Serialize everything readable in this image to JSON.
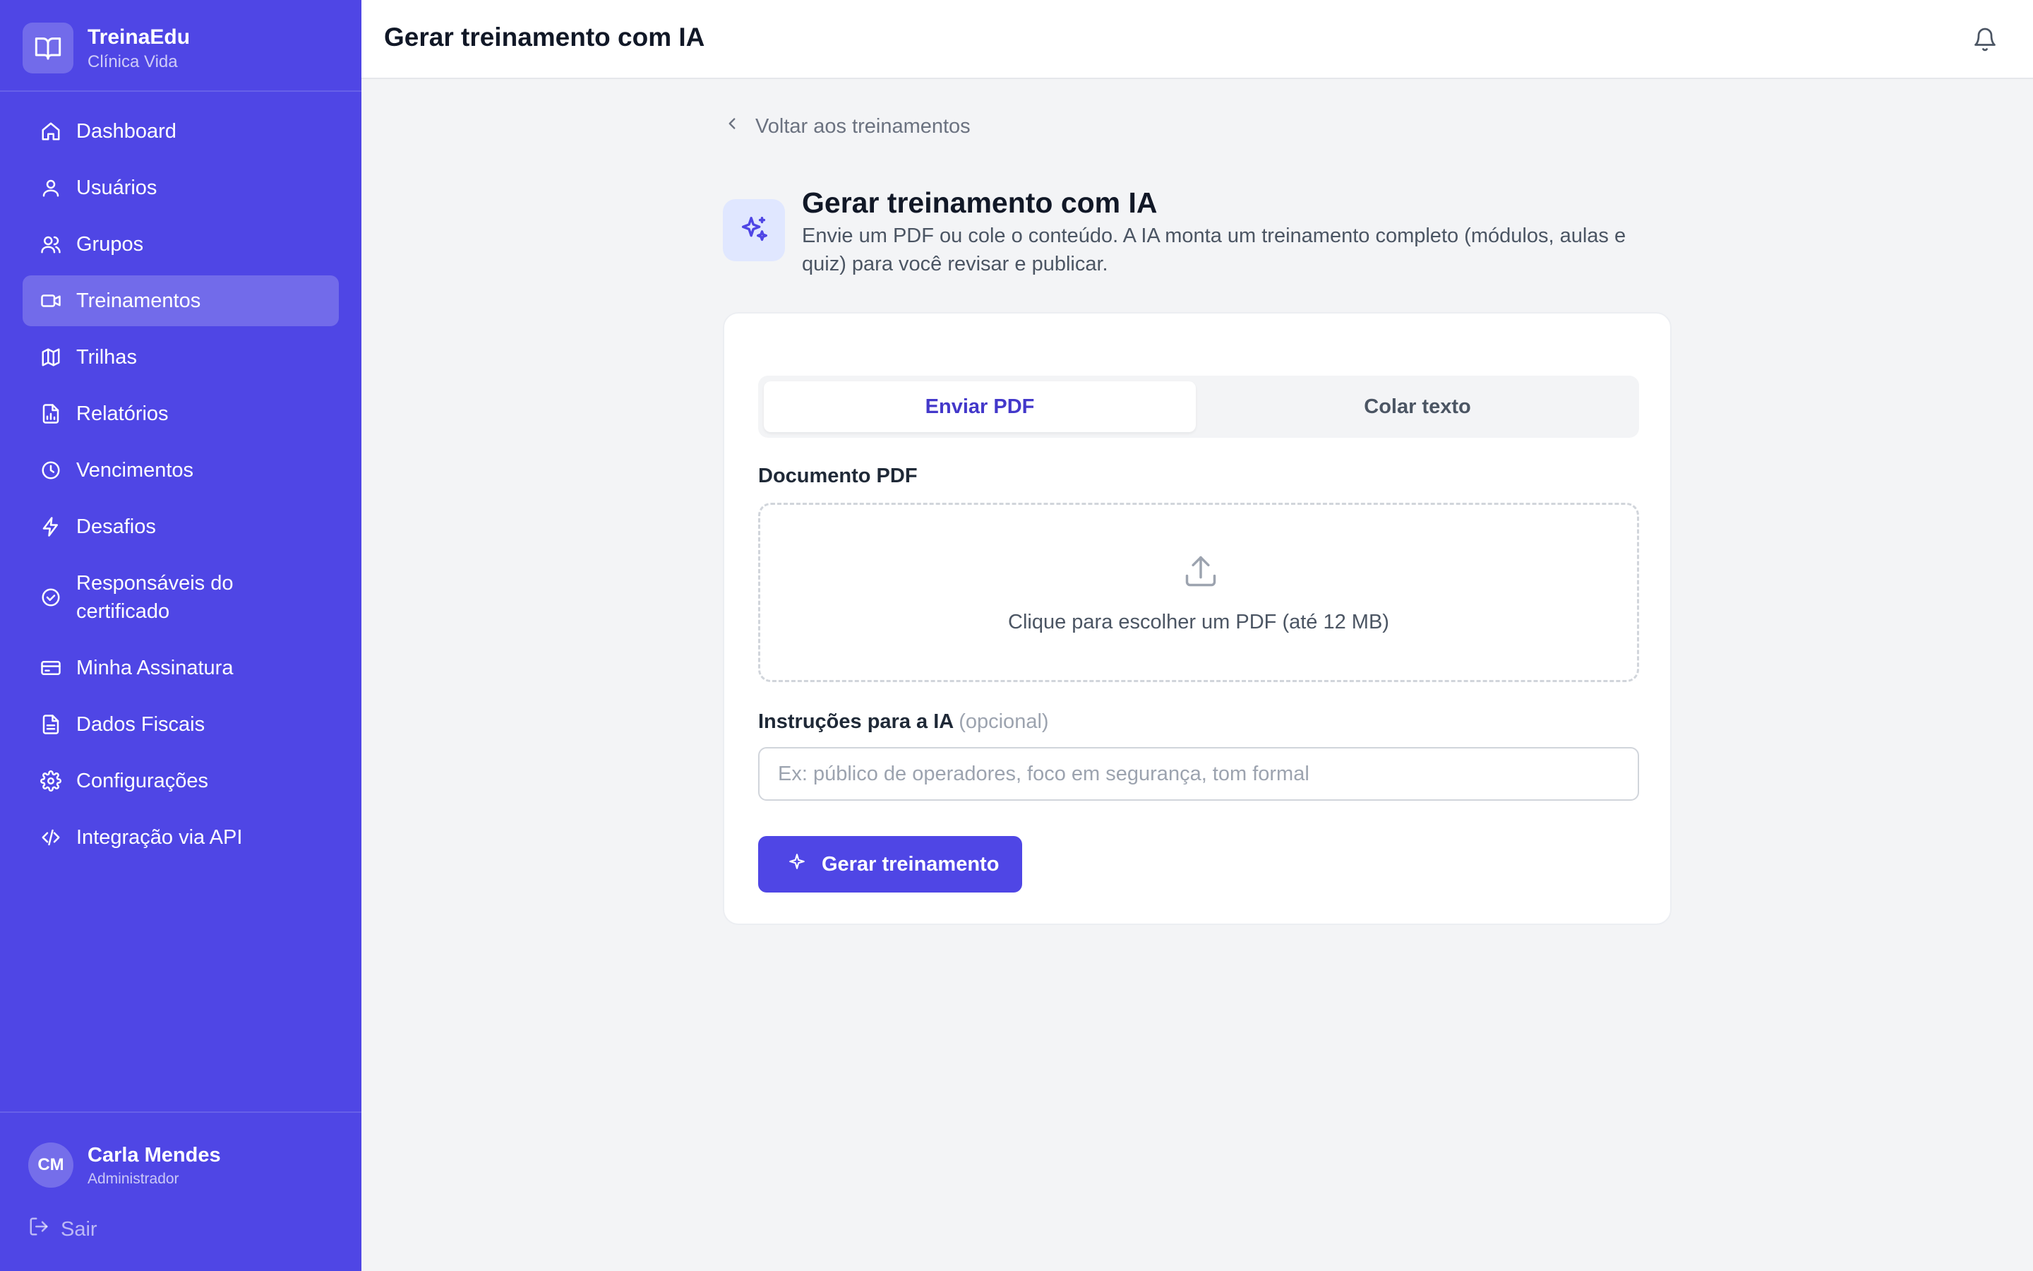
{
  "brand": {
    "name": "TreinaEdu",
    "subtitle": "Clínica Vida",
    "icon": "book-open-icon"
  },
  "sidebar": {
    "items": [
      {
        "label": "Dashboard",
        "icon": "home-icon",
        "active": false
      },
      {
        "label": "Usuários",
        "icon": "user-icon",
        "active": false
      },
      {
        "label": "Grupos",
        "icon": "users-icon",
        "active": false
      },
      {
        "label": "Treinamentos",
        "icon": "video-icon",
        "active": true
      },
      {
        "label": "Trilhas",
        "icon": "map-icon",
        "active": false
      },
      {
        "label": "Relatórios",
        "icon": "file-chart-icon",
        "active": false
      },
      {
        "label": "Vencimentos",
        "icon": "clock-icon",
        "active": false
      },
      {
        "label": "Desafios",
        "icon": "zap-icon",
        "active": false
      },
      {
        "label": "Responsáveis do certificado",
        "icon": "badge-check-icon",
        "active": false
      },
      {
        "label": "Minha Assinatura",
        "icon": "credit-card-icon",
        "active": false
      },
      {
        "label": "Dados Fiscais",
        "icon": "file-text-icon",
        "active": false
      },
      {
        "label": "Configurações",
        "icon": "gear-icon",
        "active": false
      },
      {
        "label": "Integração via API",
        "icon": "code-icon",
        "active": false
      }
    ]
  },
  "user": {
    "initials": "CM",
    "name": "Carla Mendes",
    "role": "Administrador",
    "logout_label": "Sair"
  },
  "header": {
    "title": "Gerar treinamento com IA",
    "bell_icon": "bell-icon"
  },
  "main": {
    "back_label": "Voltar aos treinamentos",
    "title": "Gerar treinamento com IA",
    "description": "Envie um PDF ou cole o conteúdo. A IA monta um treinamento completo (módulos, aulas e quiz) para você revisar e publicar.",
    "tabs": [
      {
        "label": "Enviar PDF",
        "active": true
      },
      {
        "label": "Colar texto",
        "active": false
      }
    ],
    "pdf_label": "Documento PDF",
    "dropzone_text": "Clique para escolher um PDF (até 12 MB)",
    "instructions_label": "Instruções para a IA",
    "instructions_optional": "(opcional)",
    "instructions_value": "",
    "instructions_placeholder": "Ex: público de operadores, foco em segurança, tom formal",
    "generate_label": "Gerar treinamento"
  },
  "colors": {
    "accent": "#4f46e5",
    "accent_dark": "#4338ca",
    "background": "#f3f4f6"
  }
}
